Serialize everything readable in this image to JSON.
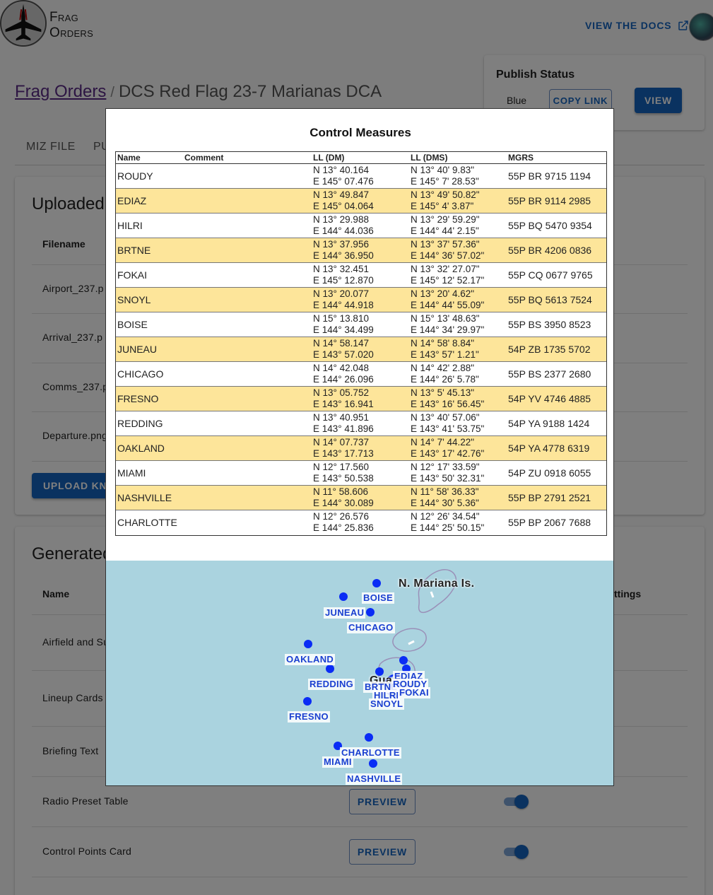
{
  "app": {
    "brand_line1": "Frag",
    "brand_line2": "Orders",
    "docs_link": "VIEW THE DOCS"
  },
  "breadcrumb": {
    "root": "Frag Orders",
    "separator": "/",
    "current": "DCS Red Flag 23-7 Marianas DCA"
  },
  "publish": {
    "title": "Publish Status",
    "coalition": "Blue",
    "copy_link": "COPY LINK",
    "view": "VIEW"
  },
  "tabs": [
    "MIZ FILE",
    "PU"
  ],
  "uploaded": {
    "title": "Uploaded",
    "column_filename": "Filename",
    "files": [
      "Airport_237.p",
      "Arrival_237.p",
      "Comms_237.p",
      "Departure.png"
    ],
    "upload_button": "UPLOAD KNE"
  },
  "generated": {
    "title": "Generated",
    "column_name": "Name",
    "column_settings": "ttings",
    "rows": [
      {
        "name": "Airfield and Su",
        "preview": ""
      },
      {
        "name": "Lineup Cards",
        "preview": ""
      },
      {
        "name": "Briefing Text",
        "preview": ""
      },
      {
        "name": "Radio Preset Table",
        "preview": "PREVIEW"
      },
      {
        "name": "Control Points Card",
        "preview": "PREVIEW"
      }
    ]
  },
  "modal": {
    "title": "Control Measures",
    "headers": {
      "name": "Name",
      "comment": "Comment",
      "ll_dm": "LL (DM)",
      "ll_dms": "LL (DMS)",
      "mgrs": "MGRS"
    },
    "rows": [
      {
        "name": "ROUDY",
        "dm_n": "N 13° 40.164",
        "dm_e": "E 145° 07.476",
        "dms_n": "N 13° 40' 9.83\"",
        "dms_e": "E 145° 7' 28.53\"",
        "mgrs": "55P BR 9715 1194"
      },
      {
        "name": "EDIAZ",
        "dm_n": "N 13° 49.847",
        "dm_e": "E 145° 04.064",
        "dms_n": "N 13° 49' 50.82\"",
        "dms_e": "E 145° 4' 3.87\"",
        "mgrs": "55P BR 9114 2985"
      },
      {
        "name": "HILRI",
        "dm_n": "N 13° 29.988",
        "dm_e": "E 144° 44.036",
        "dms_n": "N 13° 29' 59.29\"",
        "dms_e": "E 144° 44' 2.15\"",
        "mgrs": "55P BQ 5470 9354"
      },
      {
        "name": "BRTNE",
        "dm_n": "N 13° 37.956",
        "dm_e": "E 144° 36.950",
        "dms_n": "N 13° 37' 57.36\"",
        "dms_e": "E 144° 36' 57.02\"",
        "mgrs": "55P BR 4206 0836"
      },
      {
        "name": "FOKAI",
        "dm_n": "N 13° 32.451",
        "dm_e": "E 145° 12.870",
        "dms_n": "N 13° 32' 27.07\"",
        "dms_e": "E 145° 12' 52.17\"",
        "mgrs": "55P CQ 0677 9765"
      },
      {
        "name": "SNOYL",
        "dm_n": "N 13° 20.077",
        "dm_e": "E 144° 44.918",
        "dms_n": "N 13° 20' 4.62\"",
        "dms_e": "E 144° 44' 55.09\"",
        "mgrs": "55P BQ 5613 7524"
      },
      {
        "name": "BOISE",
        "dm_n": "N 15° 13.810",
        "dm_e": "E 144° 34.499",
        "dms_n": "N 15° 13' 48.63\"",
        "dms_e": "E 144° 34' 29.97\"",
        "mgrs": "55P BS 3950 8523"
      },
      {
        "name": "JUNEAU",
        "dm_n": "N 14° 58.147",
        "dm_e": "E 143° 57.020",
        "dms_n": "N 14° 58' 8.84\"",
        "dms_e": "E 143° 57' 1.21\"",
        "mgrs": "54P ZB 1735 5702"
      },
      {
        "name": "CHICAGO",
        "dm_n": "N 14° 42.048",
        "dm_e": "E 144° 26.096",
        "dms_n": "N 14° 42' 2.88\"",
        "dms_e": "E 144° 26' 5.78\"",
        "mgrs": "55P BS 2377 2680"
      },
      {
        "name": "FRESNO",
        "dm_n": "N 13° 05.752",
        "dm_e": "E 143° 16.941",
        "dms_n": "N 13° 5' 45.13\"",
        "dms_e": "E 143° 16' 56.45\"",
        "mgrs": "54P YV 4746 4885"
      },
      {
        "name": "REDDING",
        "dm_n": "N 13° 40.951",
        "dm_e": "E 143° 41.896",
        "dms_n": "N 13° 40' 57.06\"",
        "dms_e": "E 143° 41' 53.75\"",
        "mgrs": "54P YA 9188 1424"
      },
      {
        "name": "OAKLAND",
        "dm_n": "N 14° 07.737",
        "dm_e": "E 143° 17.713",
        "dms_n": "N 14° 7' 44.22\"",
        "dms_e": "E 143° 17' 42.76\"",
        "mgrs": "54P YA 4778 6319"
      },
      {
        "name": "MIAMI",
        "dm_n": "N 12° 17.560",
        "dm_e": "E 143° 50.538",
        "dms_n": "N 12° 17' 33.59\"",
        "dms_e": "E 143° 50' 32.31\"",
        "mgrs": "54P ZU 0918 6055"
      },
      {
        "name": "NASHVILLE",
        "dm_n": "N 11° 58.606",
        "dm_e": "E 144° 30.089",
        "dms_n": "N 11° 58' 36.33\"",
        "dms_e": "E 144° 30' 5.36\"",
        "mgrs": "55P BP 2791 2521"
      },
      {
        "name": "CHARLOTTE",
        "dm_n": "N 12° 26.576",
        "dm_e": "E 144° 25.836",
        "dms_n": "N 12° 26' 34.54\"",
        "dms_e": "E 144° 25' 50.15\"",
        "mgrs": "55P BP 2067 7688"
      }
    ],
    "map": {
      "island_labels": [
        "N. Mariana Is.",
        "Guam"
      ],
      "point_labels": [
        "BOISE",
        "JUNEAU",
        "CHICAGO",
        "OAKLAND",
        "REDDING",
        "FRESNO",
        "CHARLOTTE",
        "MIAMI",
        "NASHVILLE",
        "BRTNE",
        "EDIAZ",
        "ROUDY",
        "HILRI",
        "FOKAI",
        "SNOYL"
      ]
    }
  },
  "colors": {
    "primary": "#1565c0",
    "row_highlight": "#fde59a",
    "map_water": "#aad3df",
    "waypoint": "#0a2cf5"
  }
}
